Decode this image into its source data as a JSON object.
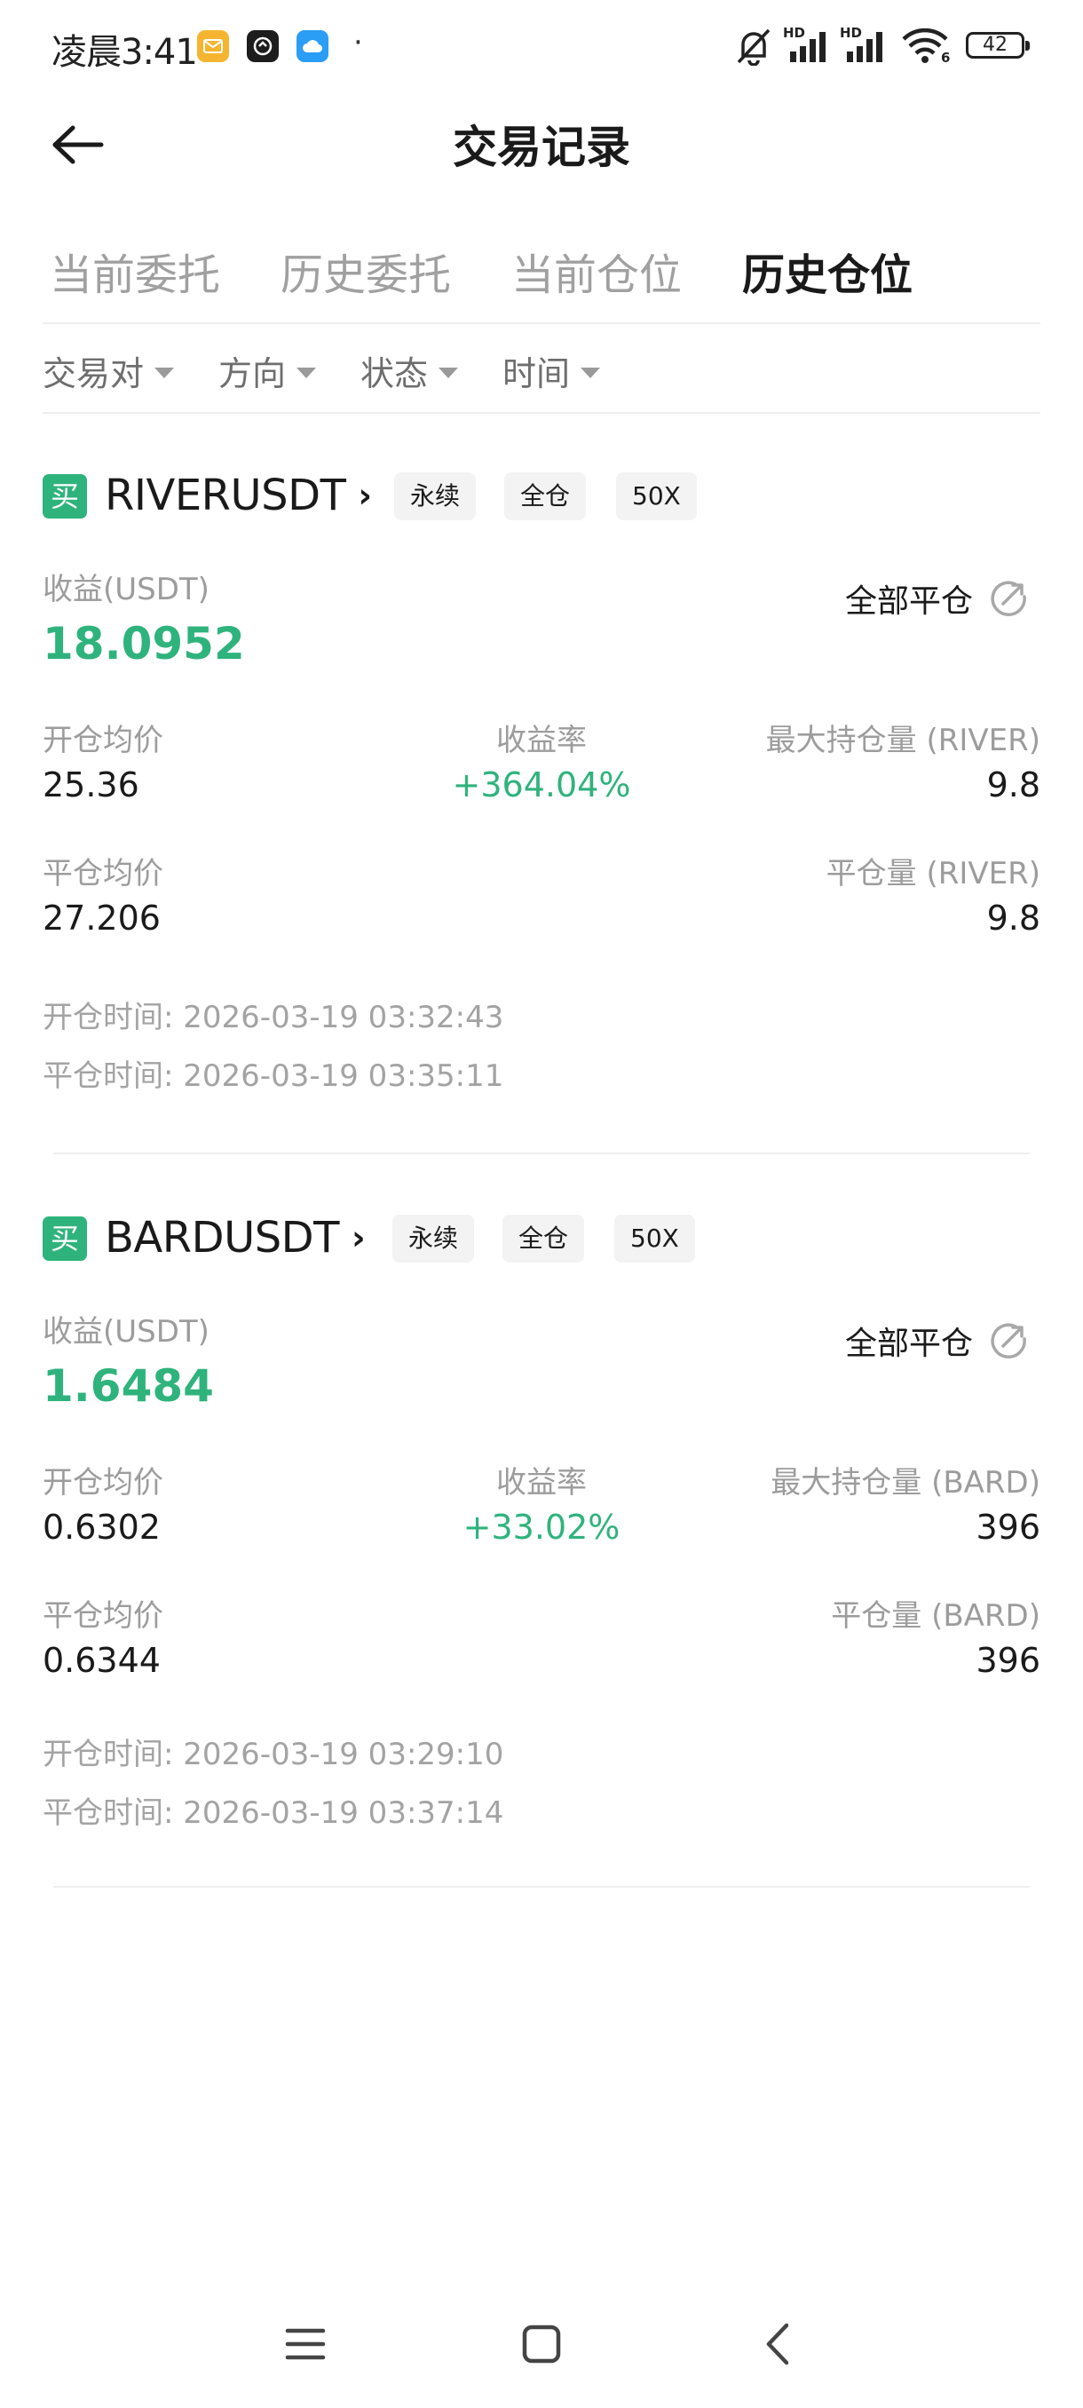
{
  "status_bar": {
    "time": "凌晨3:41",
    "dot": "·",
    "battery": "42",
    "hd_label": "HD",
    "wifi_label": "6"
  },
  "header": {
    "title": "交易记录"
  },
  "tabs": [
    {
      "label": "当前委托"
    },
    {
      "label": "历史委托"
    },
    {
      "label": "当前仓位"
    },
    {
      "label": "历史仓位"
    }
  ],
  "filters": [
    {
      "label": "交易对"
    },
    {
      "label": "方向"
    },
    {
      "label": "状态"
    },
    {
      "label": "时间"
    }
  ],
  "positions": [
    {
      "side": "买",
      "symbol": "RIVERUSDT",
      "tags": [
        "永续",
        "全仓",
        "50X"
      ],
      "profit_label": "收益(USDT)",
      "profit": "18.0952",
      "close_all": "全部平仓",
      "open_avg_label": "开仓均价",
      "open_avg": "25.36",
      "roi_label": "收益率",
      "roi": "+364.04%",
      "max_pos_label": "最大持仓量 (RIVER)",
      "max_pos": "9.8",
      "close_avg_label": "平仓均价",
      "close_avg": "27.206",
      "close_qty_label": "平仓量 (RIVER)",
      "close_qty": "9.8",
      "open_time_label": "开仓时间:",
      "open_time": "2026-03-19 03:32:43",
      "close_time_label": "平仓时间:",
      "close_time": "2026-03-19 03:35:11"
    },
    {
      "side": "买",
      "symbol": "BARDUSDT",
      "tags": [
        "永续",
        "全仓",
        "50X"
      ],
      "profit_label": "收益(USDT)",
      "profit": "1.6484",
      "close_all": "全部平仓",
      "open_avg_label": "开仓均价",
      "open_avg": "0.6302",
      "roi_label": "收益率",
      "roi": "+33.02%",
      "max_pos_label": "最大持仓量 (BARD)",
      "max_pos": "396",
      "close_avg_label": "平仓均价",
      "close_avg": "0.6344",
      "close_qty_label": "平仓量 (BARD)",
      "close_qty": "396",
      "open_time_label": "开仓时间:",
      "open_time": "2026-03-19 03:29:10",
      "close_time_label": "平仓时间:",
      "close_time": "2026-03-19 03:37:14"
    }
  ],
  "colors": {
    "accent_green": "#2fb37c",
    "text_primary": "#1a1a1a",
    "text_secondary": "#9c9c9c"
  },
  "icons": {
    "back": "back-arrow-icon",
    "share": "share-icon",
    "menu": "menu-icon",
    "home": "home-icon",
    "nav_back": "nav-back-icon"
  }
}
